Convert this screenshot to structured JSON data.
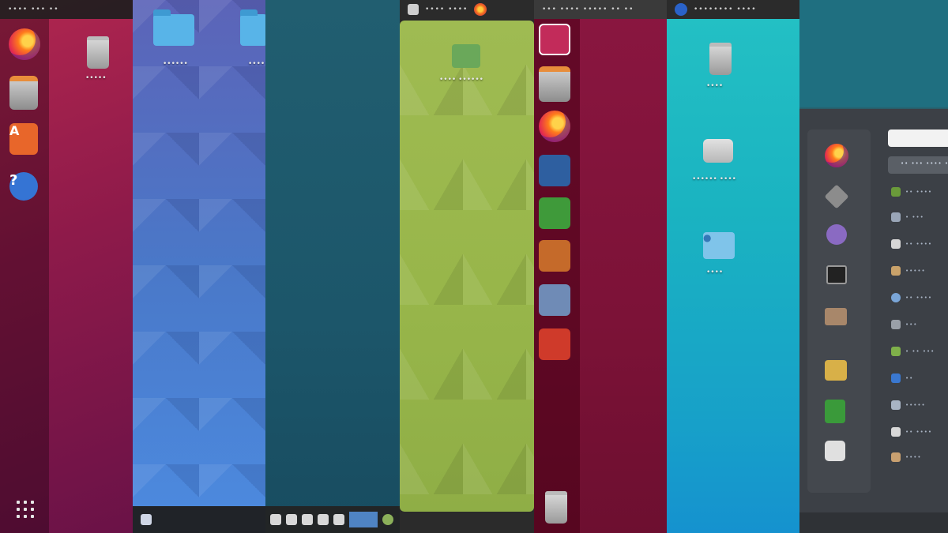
{
  "strips": [
    {
      "name": "ubuntu-18",
      "bg": "#9b1f4a"
    },
    {
      "name": "kde",
      "bg": "#4a6fc4"
    },
    {
      "name": "teal",
      "bg": "#1f5a6c"
    },
    {
      "name": "green",
      "bg": "#97b64a"
    },
    {
      "name": "unity",
      "bg": "#7f1436"
    },
    {
      "name": "cyan",
      "bg": "#1bb0bf"
    },
    {
      "name": "gnome-overview",
      "bg": "#3a3d42"
    }
  ],
  "topbars": {
    "strip1": "•••• •••   ••",
    "strip4": "••••  ••••",
    "strip5": "••• •••• ••••• •• ••",
    "strip6": "••••••••  ••••"
  },
  "icons": {
    "firefox": "firefox-icon",
    "files": "files-icon",
    "store": "software-store-icon",
    "help": "help-icon",
    "trash": "trash-icon",
    "folder": "folder-icon",
    "apps": "apps-grid-icon"
  },
  "desktop_labels": {
    "trash": "•••••",
    "folder1": "••••••",
    "folder2": "••••",
    "home": "•••• ••••••",
    "trash_cyan": "••••",
    "drive": "•••••• ••••",
    "folder_cyan": "••••"
  },
  "overview": {
    "search_placeholder": "",
    "tab_label": "•• ••• •••• ••••",
    "rows": [
      "•• ••••",
      "• •••",
      "•• ••••",
      "•••••",
      "•• ••••",
      "•••",
      "• •• •••",
      "••",
      "•••••",
      "•• ••••",
      "••••"
    ]
  }
}
